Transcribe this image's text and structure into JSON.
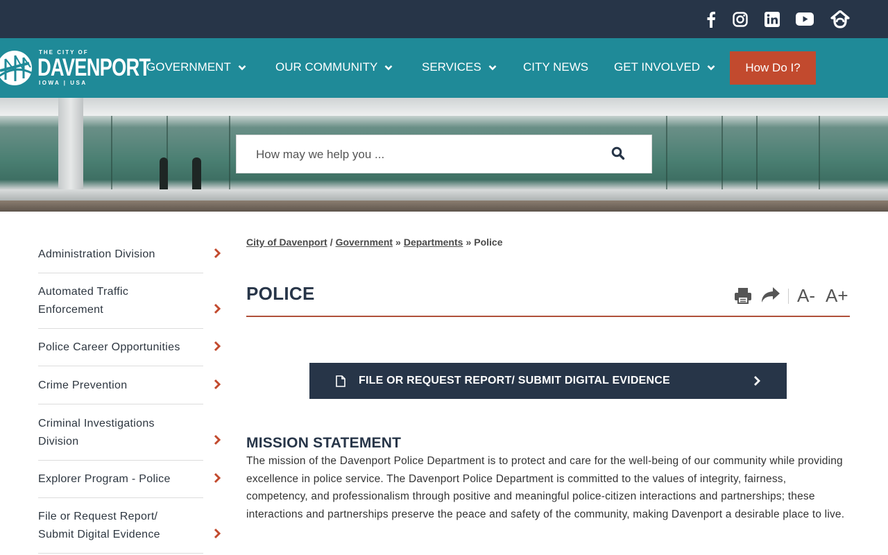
{
  "social": {
    "icons": [
      "facebook-icon",
      "instagram-icon",
      "linkedin-icon",
      "youtube-icon",
      "nextdoor-icon"
    ]
  },
  "logo": {
    "line1": "THE CITY OF",
    "line2": "DAVENPORT",
    "line3": "IOWA | USA"
  },
  "nav": {
    "items": [
      {
        "label": "GOVERNMENT",
        "dropdown": true
      },
      {
        "label": "OUR COMMUNITY",
        "dropdown": true
      },
      {
        "label": "SERVICES",
        "dropdown": true
      },
      {
        "label": "CITY NEWS",
        "dropdown": false
      },
      {
        "label": "GET INVOLVED",
        "dropdown": true
      }
    ],
    "cta": "How Do I?"
  },
  "search": {
    "placeholder": "How may we help you ..."
  },
  "sidebar": {
    "items": [
      {
        "label": "Administration Division"
      },
      {
        "label": "Automated Traffic Enforcement"
      },
      {
        "label": "Police Career Opportunities"
      },
      {
        "label": "Crime Prevention"
      },
      {
        "label": "Criminal Investigations Division"
      },
      {
        "label": "Explorer Program - Police"
      },
      {
        "label": "File or Request Report/ Submit Digital Evidence"
      }
    ]
  },
  "breadcrumb": {
    "items": [
      "City of Davenport",
      "Government",
      "Departments"
    ],
    "separators": [
      "/",
      "»",
      "»"
    ],
    "current": "Police"
  },
  "page": {
    "title": "POLICE",
    "font_decrease": "A-",
    "font_increase": "A+"
  },
  "cta_bar": {
    "label": "FILE OR REQUEST REPORT/ SUBMIT DIGITAL EVIDENCE"
  },
  "mission": {
    "heading": "MISSION STATEMENT",
    "body": "The mission of the Davenport Police Department is to protect and care for the well-being of our community while providing excellence in police service. The Davenport Police Department is committed to the values of integrity, fairness, competency, and professionalism through positive and meaningful police-citizen interactions and partnerships; these interactions and partnerships preserve the peace and safety of the community, making Davenport a desirable place to live."
  },
  "colors": {
    "topbar": "#273548",
    "nav": "#1f8a98",
    "accent": "#c24a2e",
    "dark": "#273548"
  }
}
